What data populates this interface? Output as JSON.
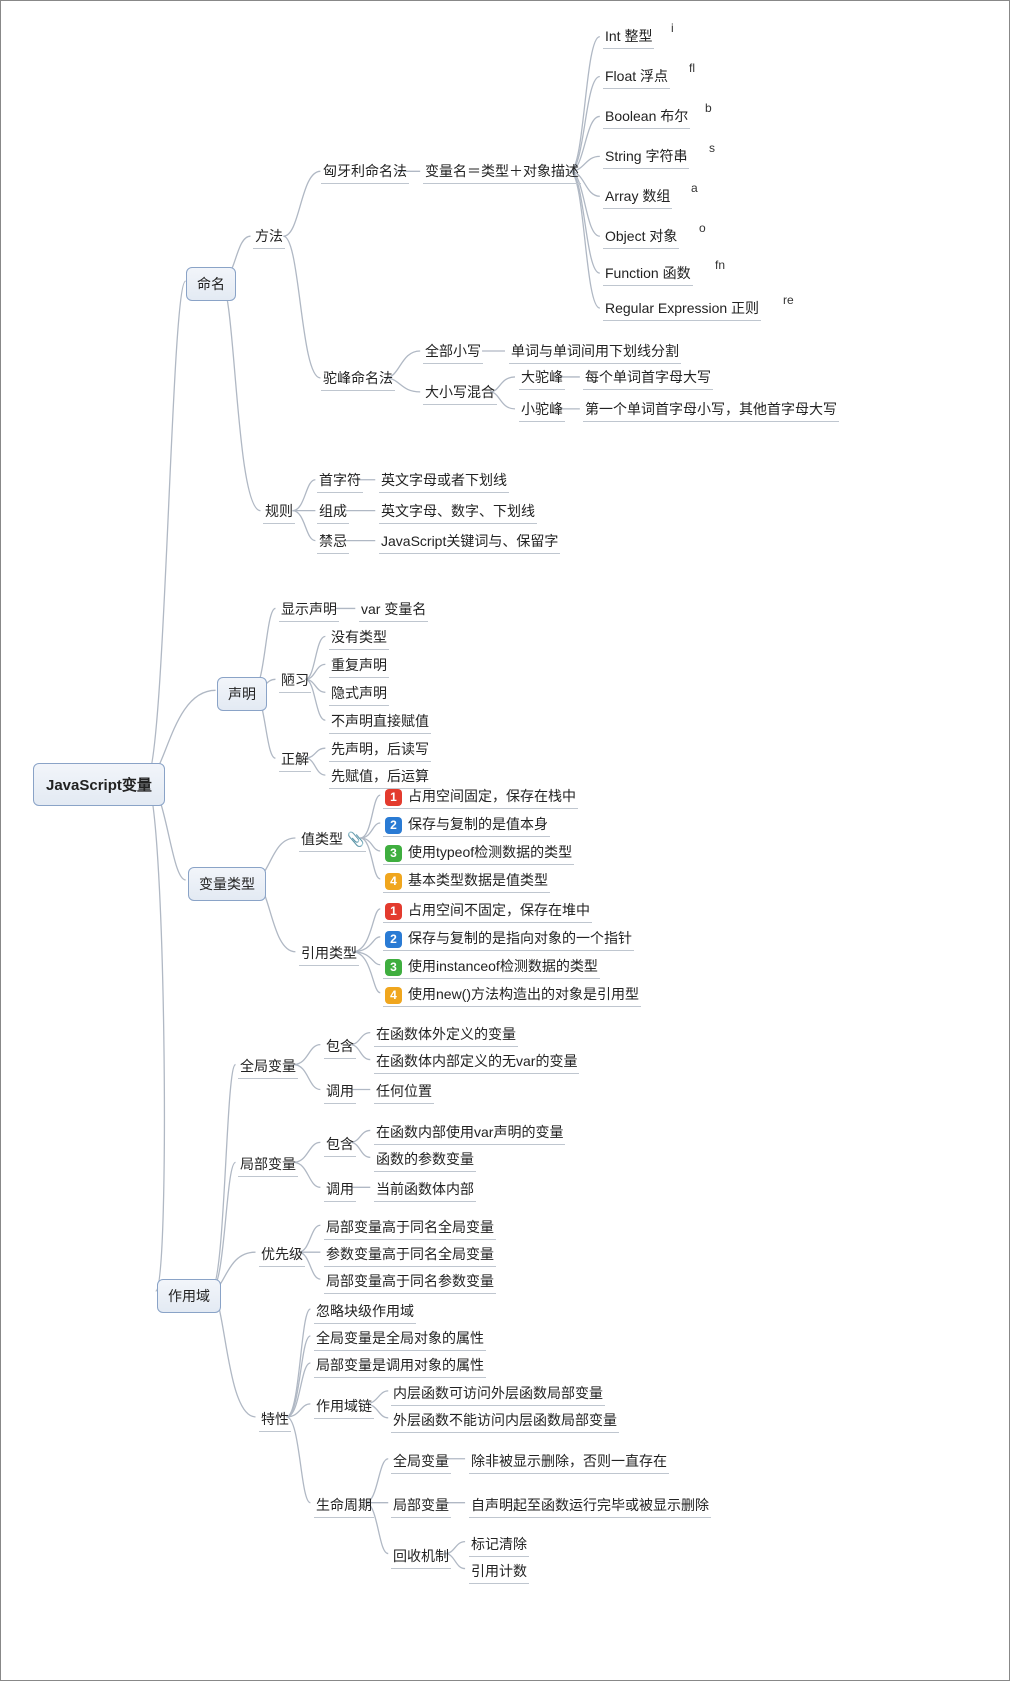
{
  "root": "JavaScript变量",
  "level1": {
    "naming": "命名",
    "decl": "声明",
    "vartype": "变量类型",
    "scope": "作用域"
  },
  "naming": {
    "method": "方法",
    "rule": "规则",
    "hungarian": "匈牙利命名法",
    "camel": "驼峰命名法",
    "formula": "变量名＝类型＋对象描述",
    "types": {
      "int": "Int 整型",
      "int_s": "i",
      "float": "Float 浮点",
      "float_s": "fl",
      "bool": "Boolean 布尔",
      "bool_s": "b",
      "string": "String 字符串",
      "string_s": "s",
      "array": "Array 数组",
      "array_s": "a",
      "object": "Object 对象",
      "object_s": "o",
      "func": "Function 函数",
      "func_s": "fn",
      "regex": "Regular Expression 正则",
      "regex_s": "re"
    },
    "camel_all_lower": "全部小写",
    "camel_all_lower_desc": "单词与单词间用下划线分割",
    "camel_mix": "大小写混合",
    "camel_big": "大驼峰",
    "camel_big_desc": "每个单词首字母大写",
    "camel_small": "小驼峰",
    "camel_small_desc": "第一个单词首字母小写，其他首字母大写",
    "rule_first": "首字符",
    "rule_first_desc": "英文字母或者下划线",
    "rule_comp": "组成",
    "rule_comp_desc": "英文字母、数字、下划线",
    "rule_taboo": "禁忌",
    "rule_taboo_desc": "JavaScript关键词与、保留字"
  },
  "decl": {
    "explicit": "显示声明",
    "explicit_desc": "var 变量名",
    "bad": "陋习",
    "bad1": "没有类型",
    "bad2": "重复声明",
    "bad3": "隐式声明",
    "bad4": "不声明直接赋值",
    "good": "正解",
    "good1": "先声明，后读写",
    "good2": "先赋值，后运算"
  },
  "vartype": {
    "value": "值类型",
    "ref": "引用类型",
    "v1": "占用空间固定，保存在栈中",
    "v2": "保存与复制的是值本身",
    "v3": "使用typeof检测数据的类型",
    "v4": "基本类型数据是值类型",
    "r1": "占用空间不固定，保存在堆中",
    "r2": "保存与复制的是指向对象的一个指针",
    "r3": "使用instanceof检测数据的类型",
    "r4": "使用new()方法构造出的对象是引用型"
  },
  "scope": {
    "global": "全局变量",
    "local": "局部变量",
    "priority": "优先级",
    "feature": "特性",
    "contain": "包含",
    "call": "调用",
    "g_c1": "在函数体外定义的变量",
    "g_c2": "在函数体内部定义的无var的变量",
    "g_call": "任何位置",
    "l_c1": "在函数内部使用var声明的变量",
    "l_c2": "函数的参数变量",
    "l_call": "当前函数体内部",
    "p1": "局部变量高于同名全局变量",
    "p2": "参数变量高于同名全局变量",
    "p3": "局部变量高于同名参数变量",
    "f1": "忽略块级作用域",
    "f2": "全局变量是全局对象的属性",
    "f3": "局部变量是调用对象的属性",
    "chain": "作用域链",
    "ch1": "内层函数可访问外层函数局部变量",
    "ch2": "外层函数不能访问内层函数局部变量",
    "life": "生命周期",
    "life_g": "全局变量",
    "life_g_desc": "除非被显示删除，否则一直存在",
    "life_l": "局部变量",
    "life_l_desc": "自声明起至函数运行完毕或被显示删除",
    "gc": "回收机制",
    "gc1": "标记清除",
    "gc2": "引用计数"
  }
}
